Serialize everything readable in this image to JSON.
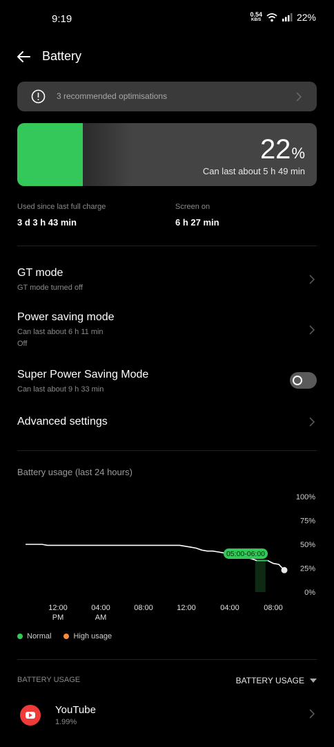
{
  "status": {
    "time": "9:19",
    "net_speed": "0.54",
    "net_unit": "KB/S",
    "battery": "22%"
  },
  "header": {
    "title": "Battery"
  },
  "recommendation": {
    "text": "3 recommended optimisations"
  },
  "battery": {
    "level": 22,
    "level_text": "22",
    "percent_sign": "%",
    "estimate": "Can last about 5 h 49 min",
    "fill_color": "#34c759"
  },
  "stats": {
    "used_label": "Used since last full charge",
    "used_value": "3 d 3 h 43 min",
    "screen_label": "Screen on",
    "screen_value": "6 h 27 min"
  },
  "settings": {
    "gt_mode": {
      "title": "GT mode",
      "sub": "GT mode turned off"
    },
    "power_saving": {
      "title": "Power saving mode",
      "sub": "Can last about 6 h 11 min",
      "sub2": "Off"
    },
    "super_power": {
      "title": "Super Power Saving Mode",
      "sub": "Can last about 9 h 33 min",
      "enabled": false
    },
    "advanced": {
      "title": "Advanced settings"
    }
  },
  "usage": {
    "title": "Battery usage (last 24 hours)"
  },
  "chart_data": {
    "type": "line",
    "y_ticks": [
      "100%",
      "75%",
      "50%",
      "25%",
      "0%"
    ],
    "ylim": [
      0,
      100
    ],
    "x_ticks": [
      {
        "line1": "12:00",
        "line2": "PM"
      },
      {
        "line1": "04:00",
        "line2": "AM"
      },
      {
        "line1": "08:00",
        "line2": ""
      },
      {
        "line1": "12:00",
        "line2": ""
      },
      {
        "line1": "04:00",
        "line2": ""
      },
      {
        "line1": "08:00",
        "line2": ""
      }
    ],
    "x_hours": [
      0,
      3,
      4,
      9,
      11,
      12,
      13,
      14,
      15,
      17,
      20,
      22,
      23,
      25,
      26.5,
      28,
      30,
      31,
      32,
      33,
      34,
      35,
      36,
      37,
      38,
      39,
      40,
      41,
      42,
      43,
      44,
      45,
      46,
      47
    ],
    "values": [
      50,
      50,
      49,
      49,
      49,
      49,
      49,
      49,
      49,
      49,
      49,
      49,
      49,
      49,
      49,
      49,
      47,
      46,
      44,
      43,
      43,
      42,
      41,
      39,
      38,
      38,
      36,
      35,
      33,
      33,
      33,
      30,
      29,
      23
    ],
    "highlight": {
      "label": "05:00-06:00",
      "color": "#34c759"
    },
    "legend": [
      {
        "name": "Normal",
        "color": "#34c759"
      },
      {
        "name": "High usage",
        "color": "#ff8a3d"
      }
    ],
    "line_color": "#ffffff"
  },
  "usage_list": {
    "header_left": "BATTERY USAGE",
    "header_right": "BATTERY USAGE",
    "apps": [
      {
        "name": "YouTube",
        "percent": "1.99%"
      }
    ]
  }
}
